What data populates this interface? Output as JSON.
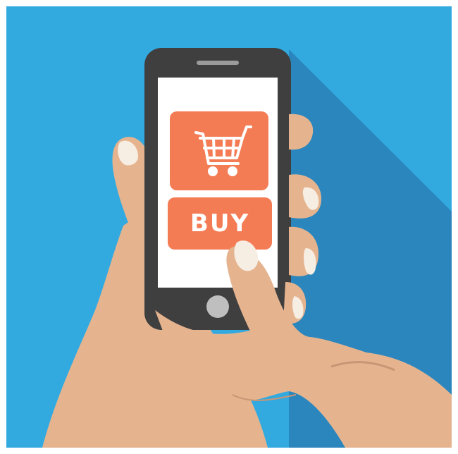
{
  "screen": {
    "buy_button_label": "BUY",
    "cart_icon": "shopping-cart-icon",
    "home_button_icon": "home-button-icon"
  },
  "colors": {
    "background": "#33aadf",
    "shadow": "#2a86bd",
    "phone_body": "#3f3f3f",
    "screen_bg": "#ffffff",
    "accent_orange": "#f47c55",
    "skin": "#e5b48f",
    "skin_shade": "#c99575",
    "nail": "#f6ede3",
    "home_button": "#bfbfbf"
  }
}
